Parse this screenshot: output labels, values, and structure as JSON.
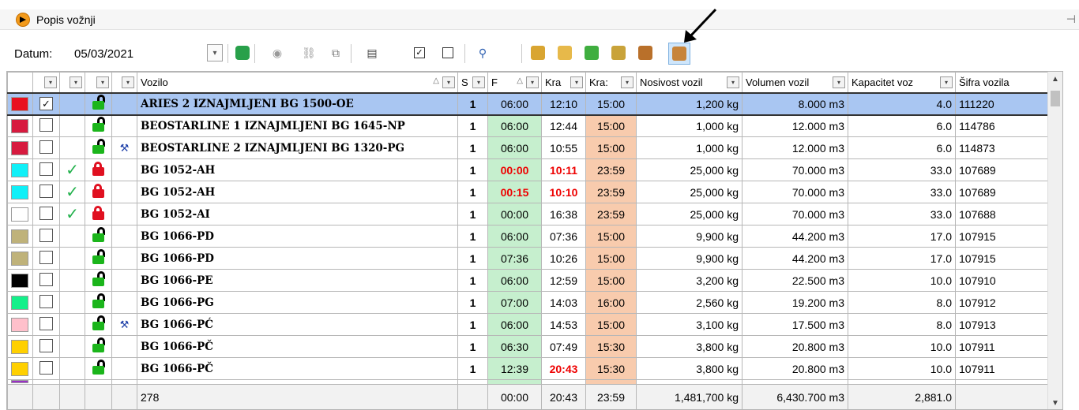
{
  "window": {
    "title": "Popis vožnji"
  },
  "toolbar": {
    "date_label": "Datum:",
    "date_value": "05/03/2021"
  },
  "columns": {
    "vozilo": "Vozilo",
    "s": "S",
    "p": "F",
    "kra1": "Kra",
    "kra2": "Kra:",
    "nosivost": "Nosivost vozil",
    "volumen": "Volumen vozil",
    "kapacitet": "Kapacitet voz",
    "sifra": "Šifra vozila"
  },
  "rows": [
    {
      "color": "#e8101f",
      "checked": true,
      "ok": false,
      "lock": "unlocked",
      "tool": false,
      "name": "ARIES 2 IZNAJMLJENI BG 1500-OE",
      "s": "1",
      "p": "06:00",
      "p_red": false,
      "k1": "12:10",
      "k1_red": false,
      "k2": "15:00",
      "nos": "1,200 kg",
      "vol": "8.000 m3",
      "kap": "4.0",
      "sif": "111220",
      "selected": true
    },
    {
      "color": "#d71a3f",
      "checked": false,
      "ok": false,
      "lock": "unlocked",
      "tool": false,
      "name": "BEOSTARLINE 1 IZNAJMLJENI BG 1645-NP",
      "s": "1",
      "p": "06:00",
      "p_red": false,
      "k1": "12:44",
      "k1_red": false,
      "k2": "15:00",
      "nos": "1,000 kg",
      "vol": "12.000 m3",
      "kap": "6.0",
      "sif": "114786"
    },
    {
      "color": "#d71a3f",
      "checked": false,
      "ok": false,
      "lock": "unlocked",
      "tool": true,
      "name": "BEOSTARLINE 2 IZNAJMLJENI BG 1320-PG",
      "s": "1",
      "p": "06:00",
      "p_red": false,
      "k1": "10:55",
      "k1_red": false,
      "k2": "15:00",
      "nos": "1,000 kg",
      "vol": "12.000 m3",
      "kap": "6.0",
      "sif": "114873"
    },
    {
      "color": "#10f0f8",
      "checked": false,
      "ok": true,
      "lock": "locked",
      "tool": false,
      "name": "BG 1052-AH",
      "s": "1",
      "p": "00:00",
      "p_red": true,
      "k1": "10:11",
      "k1_red": true,
      "k2": "23:59",
      "nos": "25,000 kg",
      "vol": "70.000 m3",
      "kap": "33.0",
      "sif": "107689"
    },
    {
      "color": "#10f0f8",
      "checked": false,
      "ok": true,
      "lock": "locked",
      "tool": false,
      "name": "BG 1052-AH",
      "s": "1",
      "p": "00:15",
      "p_red": true,
      "k1": "10:10",
      "k1_red": true,
      "k2": "23:59",
      "nos": "25,000 kg",
      "vol": "70.000 m3",
      "kap": "33.0",
      "sif": "107689"
    },
    {
      "color": "#ffffff",
      "checked": false,
      "ok": true,
      "lock": "locked",
      "tool": false,
      "name": "BG 1052-AI",
      "s": "1",
      "p": "00:00",
      "p_red": false,
      "k1": "16:38",
      "k1_red": false,
      "k2": "23:59",
      "nos": "25,000 kg",
      "vol": "70.000 m3",
      "kap": "33.0",
      "sif": "107688"
    },
    {
      "color": "#bfb27a",
      "checked": false,
      "ok": false,
      "lock": "unlocked",
      "tool": false,
      "name": "BG 1066-PD",
      "s": "1",
      "p": "06:00",
      "p_red": false,
      "k1": "07:36",
      "k1_red": false,
      "k2": "15:00",
      "nos": "9,900 kg",
      "vol": "44.200 m3",
      "kap": "17.0",
      "sif": "107915"
    },
    {
      "color": "#bfb27a",
      "checked": false,
      "ok": false,
      "lock": "unlocked",
      "tool": false,
      "name": "BG 1066-PD",
      "s": "1",
      "p": "07:36",
      "p_red": false,
      "k1": "10:26",
      "k1_red": false,
      "k2": "15:00",
      "nos": "9,900 kg",
      "vol": "44.200 m3",
      "kap": "17.0",
      "sif": "107915"
    },
    {
      "color": "#000000",
      "checked": false,
      "ok": false,
      "lock": "unlocked",
      "tool": false,
      "name": "BG 1066-PE",
      "s": "1",
      "p": "06:00",
      "p_red": false,
      "k1": "12:59",
      "k1_red": false,
      "k2": "15:00",
      "nos": "3,200 kg",
      "vol": "22.500 m3",
      "kap": "10.0",
      "sif": "107910"
    },
    {
      "color": "#14f08a",
      "checked": false,
      "ok": false,
      "lock": "unlocked",
      "tool": false,
      "name": "BG 1066-PG",
      "s": "1",
      "p": "07:00",
      "p_red": false,
      "k1": "14:03",
      "k1_red": false,
      "k2": "16:00",
      "nos": "2,560 kg",
      "vol": "19.200 m3",
      "kap": "8.0",
      "sif": "107912"
    },
    {
      "color": "#ffc0cb",
      "checked": false,
      "ok": false,
      "lock": "unlocked",
      "tool": true,
      "name": "BG 1066-PĆ",
      "s": "1",
      "p": "06:00",
      "p_red": false,
      "k1": "14:53",
      "k1_red": false,
      "k2": "15:00",
      "nos": "3,100 kg",
      "vol": "17.500 m3",
      "kap": "8.0",
      "sif": "107913"
    },
    {
      "color": "#ffd000",
      "checked": false,
      "ok": false,
      "lock": "unlocked",
      "tool": false,
      "name": "BG 1066-PČ",
      "s": "1",
      "p": "06:30",
      "p_red": false,
      "k1": "07:49",
      "k1_red": false,
      "k2": "15:30",
      "nos": "3,800 kg",
      "vol": "20.800 m3",
      "kap": "10.0",
      "sif": "107911"
    },
    {
      "color": "#ffd000",
      "checked": false,
      "ok": false,
      "lock": "unlocked",
      "tool": false,
      "name": "BG 1066-PČ",
      "s": "1",
      "p": "12:39",
      "p_red": false,
      "k1": "20:43",
      "k1_red": true,
      "k2": "15:30",
      "nos": "3,800 kg",
      "vol": "20.800 m3",
      "kap": "10.0",
      "sif": "107911"
    }
  ],
  "footer": {
    "count": "278",
    "p": "00:00",
    "k1": "20:43",
    "k2": "23:59",
    "nos": "1,481,700 kg",
    "vol": "6,430.700 m3",
    "kap": "2,881.0"
  }
}
